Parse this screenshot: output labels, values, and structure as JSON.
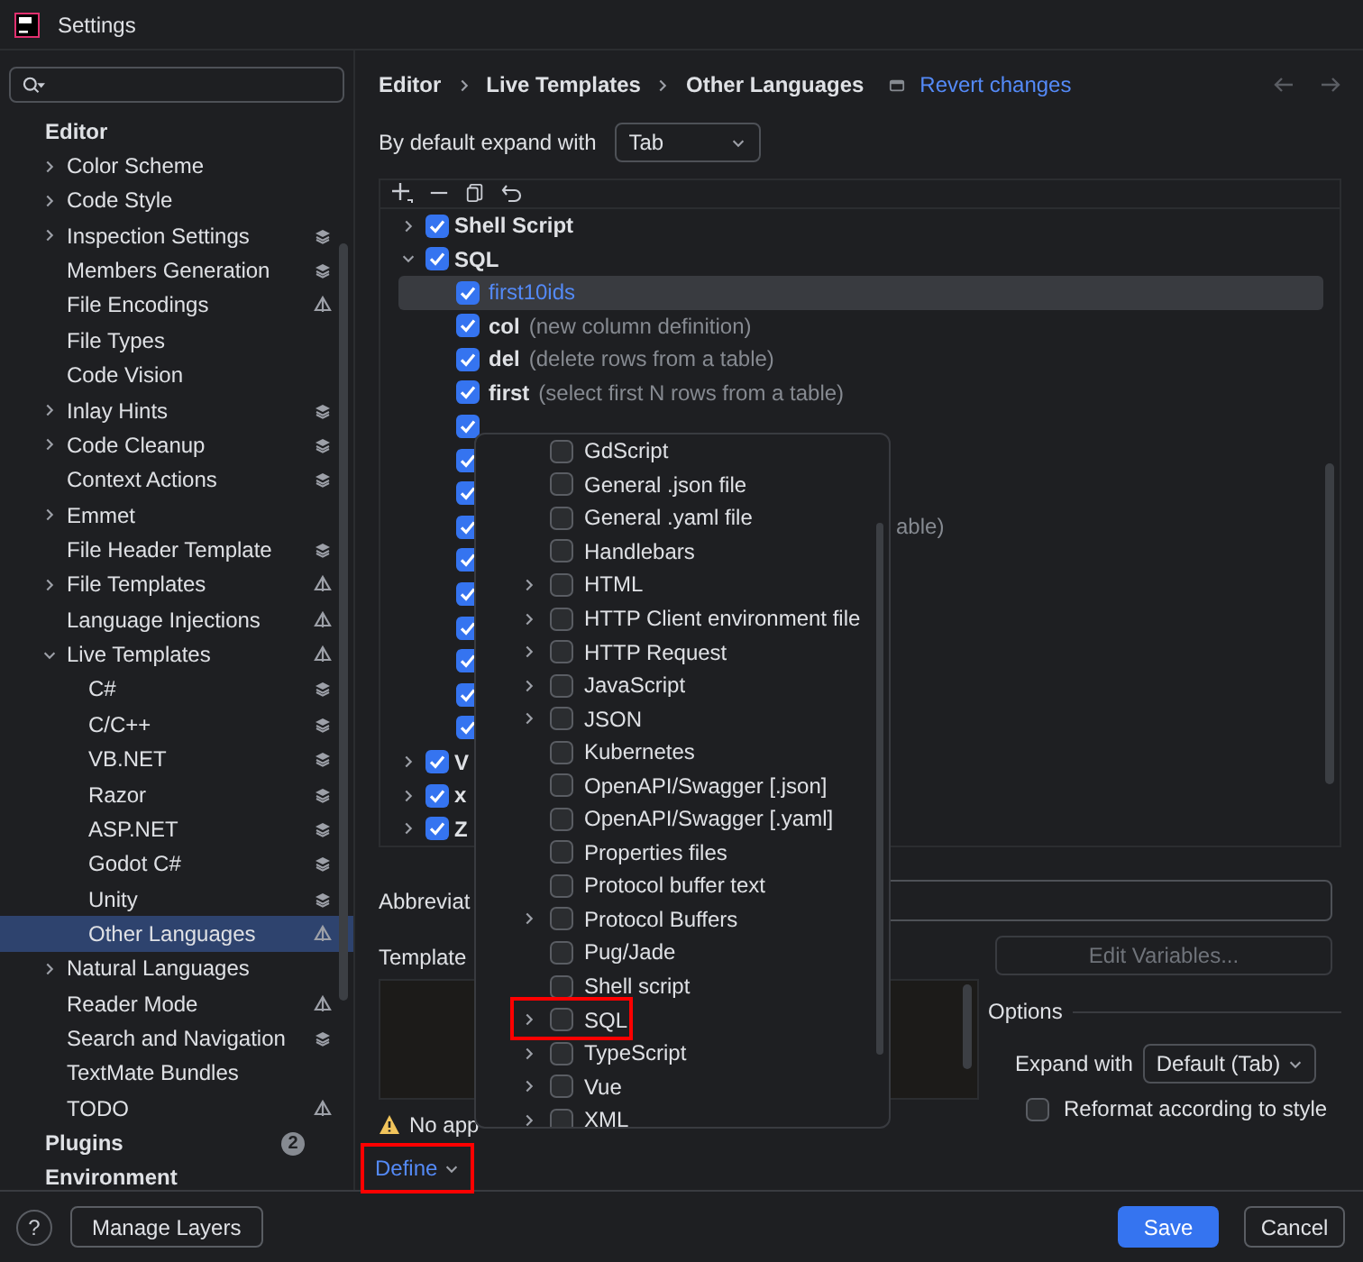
{
  "window": {
    "title": "Settings"
  },
  "sidebar": {
    "sections": [
      {
        "label": "Editor",
        "children": [
          {
            "label": "Color Scheme",
            "expanded": false,
            "selected": false
          },
          {
            "label": "Code Style",
            "expanded": false,
            "selected": false
          },
          {
            "label": "Inspection Settings",
            "expanded": false,
            "selected": false,
            "kind": "layers"
          },
          {
            "label": "Members Generation",
            "selected": false,
            "kind": "layers"
          },
          {
            "label": "File Encodings",
            "selected": false,
            "kind": "shared"
          },
          {
            "label": "File Types",
            "selected": false
          },
          {
            "label": "Code Vision",
            "selected": false
          },
          {
            "label": "Inlay Hints",
            "expanded": false,
            "selected": false,
            "kind": "layers"
          },
          {
            "label": "Code Cleanup",
            "expanded": false,
            "selected": false,
            "kind": "layers"
          },
          {
            "label": "Context Actions",
            "selected": false,
            "kind": "layers"
          },
          {
            "label": "Emmet",
            "expanded": false,
            "selected": false
          },
          {
            "label": "File Header Template",
            "selected": false,
            "kind": "layers"
          },
          {
            "label": "File Templates",
            "expanded": false,
            "selected": false,
            "kind": "shared"
          },
          {
            "label": "Language Injections",
            "selected": false,
            "kind": "shared"
          },
          {
            "label": "Live Templates",
            "expanded": true,
            "selected": false,
            "kind": "shared",
            "children": [
              {
                "label": "C#",
                "selected": false,
                "kind": "layers"
              },
              {
                "label": "C/C++",
                "selected": false,
                "kind": "layers"
              },
              {
                "label": "VB.NET",
                "selected": false,
                "kind": "layers"
              },
              {
                "label": "Razor",
                "selected": false,
                "kind": "layers"
              },
              {
                "label": "ASP.NET",
                "selected": false,
                "kind": "layers"
              },
              {
                "label": "Godot C#",
                "selected": false,
                "kind": "layers"
              },
              {
                "label": "Unity",
                "selected": false,
                "kind": "layers"
              },
              {
                "label": "Other Languages",
                "selected": true,
                "kind": "shared"
              }
            ]
          },
          {
            "label": "Natural Languages",
            "expanded": false,
            "selected": false
          },
          {
            "label": "Reader Mode",
            "selected": false,
            "kind": "shared"
          },
          {
            "label": "Search and Navigation",
            "selected": false,
            "kind": "layers"
          },
          {
            "label": "TextMate Bundles",
            "selected": false
          },
          {
            "label": "TODO",
            "selected": false,
            "kind": "shared"
          }
        ]
      },
      {
        "label": "Plugins",
        "count": "2"
      },
      {
        "label": "Environment"
      }
    ]
  },
  "breadcrumb": [
    "Editor",
    "Live Templates",
    "Other Languages"
  ],
  "revert_link": "Revert changes",
  "expand_default": {
    "label": "By default expand with",
    "value": "Tab"
  },
  "templates": [
    {
      "label": "Shell Script",
      "checked": true,
      "expanded": false
    },
    {
      "label": "SQL",
      "checked": true,
      "expanded": true,
      "children": [
        {
          "name": "first10ids",
          "checked": true,
          "selected": true
        },
        {
          "name": "col",
          "description": "(new column definition)",
          "checked": true,
          "selected": false
        },
        {
          "name": "del",
          "description": "(delete rows from a table)",
          "checked": true,
          "selected": false
        },
        {
          "name": "first",
          "description": "(select first N rows from a table)",
          "checked": true,
          "selected": false
        },
        {
          "checked": true
        },
        {
          "checked": true
        },
        {
          "checked": true
        },
        {
          "checked": true,
          "description": "able)"
        },
        {
          "checked": true
        },
        {
          "checked": true
        },
        {
          "checked": true
        },
        {
          "checked": true
        },
        {
          "checked": true
        },
        {
          "checked": true
        }
      ]
    },
    {
      "label": "V",
      "checked": true,
      "expanded": false
    },
    {
      "label": "x",
      "checked": true,
      "expanded": false
    },
    {
      "label": "Z",
      "checked": true,
      "expanded": false
    }
  ],
  "abbreviation_label": "Abbreviat",
  "template_text_label": "Template",
  "edit_variables": "Edit Variables...",
  "options": {
    "title": "Options",
    "expand_label": "Expand with",
    "expand_value": "Default (Tab)",
    "reformat": {
      "label": "Reformat according to style",
      "checked": false
    }
  },
  "warning": "No app",
  "define": {
    "label": "Define",
    "highlighted": true
  },
  "context_popup": [
    {
      "label": "GdScript",
      "checked": false
    },
    {
      "label": "General .json file",
      "checked": false
    },
    {
      "label": "General .yaml file",
      "checked": false
    },
    {
      "label": "Handlebars",
      "checked": false
    },
    {
      "label": "HTML",
      "checked": false,
      "expanded": false
    },
    {
      "label": "HTTP Client environment file",
      "checked": false,
      "expanded": false
    },
    {
      "label": "HTTP Request",
      "checked": false,
      "expanded": false
    },
    {
      "label": "JavaScript",
      "checked": false,
      "expanded": false
    },
    {
      "label": "JSON",
      "checked": false,
      "expanded": false
    },
    {
      "label": "Kubernetes",
      "checked": false
    },
    {
      "label": "OpenAPI/Swagger [.json]",
      "checked": false
    },
    {
      "label": "OpenAPI/Swagger [.yaml]",
      "checked": false
    },
    {
      "label": "Properties files",
      "checked": false
    },
    {
      "label": "Protocol buffer text",
      "checked": false
    },
    {
      "label": "Protocol Buffers",
      "checked": false,
      "expanded": false
    },
    {
      "label": "Pug/Jade",
      "checked": false
    },
    {
      "label": "Shell script",
      "checked": false
    },
    {
      "label": "SQL",
      "checked": false,
      "expanded": false,
      "highlighted": true
    },
    {
      "label": "TypeScript",
      "checked": false,
      "expanded": false
    },
    {
      "label": "Vue",
      "checked": false,
      "expanded": false
    },
    {
      "label": "XML",
      "checked": false,
      "expanded": false
    }
  ],
  "footer": {
    "help": "?",
    "manage_layers": "Manage Layers",
    "save": "Save",
    "cancel": "Cancel"
  }
}
